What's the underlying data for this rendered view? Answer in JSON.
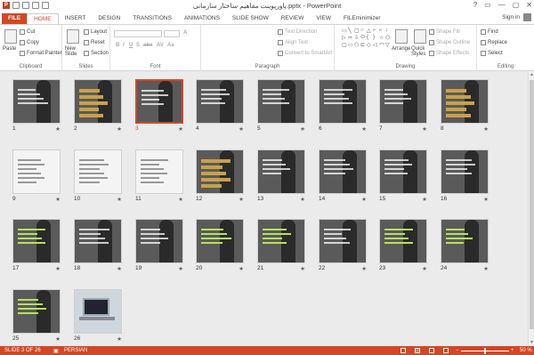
{
  "titlebar": {
    "title": "پاورپوینت مفاهیم ساختار سازمانی.pptx - PowerPoint",
    "controls": [
      "?",
      "▭",
      "—",
      "▢",
      "✕"
    ]
  },
  "tabs": [
    "FILE",
    "HOME",
    "INSERT",
    "DESIGN",
    "TRANSITIONS",
    "ANIMATIONS",
    "SLIDE SHOW",
    "REVIEW",
    "VIEW",
    "FILEminimizer"
  ],
  "active_tab": "HOME",
  "signin": "Sign in",
  "ribbon": {
    "clipboard": {
      "label": "Clipboard",
      "paste": "Paste",
      "cut": "Cut",
      "copy": "Copy",
      "format_painter": "Format Painter"
    },
    "slides": {
      "label": "Slides",
      "new_slide": "New Slide",
      "layout": "Layout",
      "reset": "Reset",
      "section": "Section"
    },
    "font": {
      "label": "Font",
      "buttons": [
        "B",
        "I",
        "U",
        "S",
        "abc",
        "AV",
        "Aa",
        "A"
      ]
    },
    "paragraph": {
      "label": "Paragraph",
      "text_direction": "Text Direction",
      "align_text": "Align Text",
      "convert_smartart": "Convert to SmartArt"
    },
    "drawing": {
      "label": "Drawing",
      "arrange": "Arrange",
      "quick_styles": "Quick Styles",
      "shape_fill": "Shape Fill",
      "shape_outline": "Shape Outline",
      "shape_effects": "Shape Effects",
      "shapes": [
        "▭",
        "╲",
        "▢",
        "○",
        "△",
        "⌐",
        "⌐",
        "↓",
        "▷",
        "⇨",
        "⇩",
        "⬭",
        "{",
        "}",
        "☆",
        "⬡",
        "▢",
        "▭",
        "⬠",
        "⊏",
        "◇",
        "◁",
        "⌒",
        "▽"
      ]
    },
    "editing": {
      "label": "Editing",
      "find": "Find",
      "replace": "Replace",
      "select": "Select"
    }
  },
  "slides": [
    {
      "num": "1",
      "style": "dark"
    },
    {
      "num": "2",
      "style": "gold"
    },
    {
      "num": "3",
      "style": "dark",
      "selected": true
    },
    {
      "num": "4",
      "style": "dark"
    },
    {
      "num": "5",
      "style": "dark"
    },
    {
      "num": "6",
      "style": "dark"
    },
    {
      "num": "7",
      "style": "dark"
    },
    {
      "num": "8",
      "style": "gold"
    },
    {
      "num": "9",
      "style": "light"
    },
    {
      "num": "10",
      "style": "light"
    },
    {
      "num": "11",
      "style": "light"
    },
    {
      "num": "12",
      "style": "gold"
    },
    {
      "num": "13",
      "style": "dark"
    },
    {
      "num": "14",
      "style": "dark"
    },
    {
      "num": "15",
      "style": "dark"
    },
    {
      "num": "16",
      "style": "dark"
    },
    {
      "num": "17",
      "style": "green"
    },
    {
      "num": "18",
      "style": "dark"
    },
    {
      "num": "19",
      "style": "dark"
    },
    {
      "num": "20",
      "style": "green"
    },
    {
      "num": "21",
      "style": "green"
    },
    {
      "num": "22",
      "style": "dark"
    },
    {
      "num": "23",
      "style": "green"
    },
    {
      "num": "24",
      "style": "green"
    },
    {
      "num": "25",
      "style": "green"
    },
    {
      "num": "26",
      "style": "laptop"
    }
  ],
  "statusbar": {
    "slide_info": "SLIDE 3 OF 26",
    "language": "PERSIAN",
    "zoom": "50 %",
    "zoom_level": 50
  },
  "colors": {
    "accent": "#d24726",
    "sorter_bg": "#ebebeb"
  }
}
